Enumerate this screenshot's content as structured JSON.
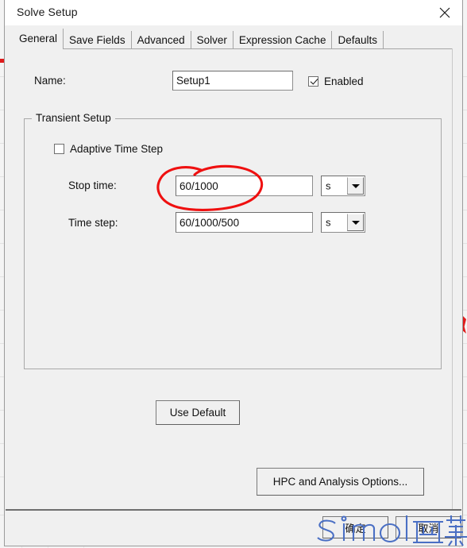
{
  "window": {
    "title": "Solve Setup",
    "close_icon": "close-icon"
  },
  "tabs": [
    {
      "label": "General",
      "active": true
    },
    {
      "label": "Save Fields",
      "active": false
    },
    {
      "label": "Advanced",
      "active": false
    },
    {
      "label": "Solver",
      "active": false
    },
    {
      "label": "Expression Cache",
      "active": false
    },
    {
      "label": "Defaults",
      "active": false
    }
  ],
  "general": {
    "name_label": "Name:",
    "name_value": "Setup1",
    "enabled_label": "Enabled",
    "enabled_checked": true,
    "group_title": "Transient Setup",
    "adaptive_label": "Adaptive Time Step",
    "adaptive_checked": false,
    "stop_time_label": "Stop time:",
    "stop_time_value": "60/1000",
    "stop_time_unit": "s",
    "time_step_label": "Time step:",
    "time_step_value": "60/1000/500",
    "time_step_unit": "s",
    "unit_dropdown_icon": "chevron-down-icon"
  },
  "buttons": {
    "use_default": "Use Default",
    "hpc_options": "HPC and Analysis Options...",
    "ok": "确定",
    "cancel": "取消"
  },
  "annotation": {
    "type": "hand-drawn-ellipse",
    "color": "#ef1010",
    "targets": "stop_time_value"
  },
  "watermark": {
    "text_latin": "simol",
    "text_cjk": "西莫",
    "color": "#4a6fc4"
  }
}
